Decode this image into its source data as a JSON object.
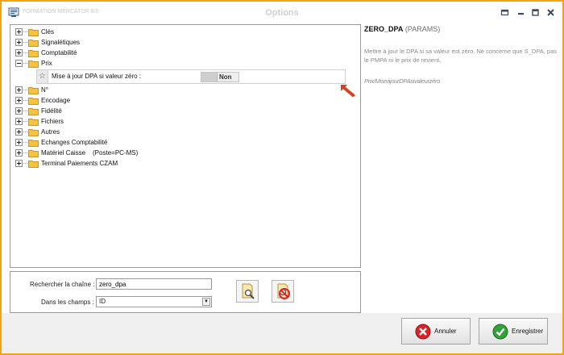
{
  "window": {
    "app_title": "FORMATION MERCATOR 8/0",
    "title": "Options"
  },
  "tree": {
    "items_before": [
      {
        "label": "Clés"
      },
      {
        "label": "Signalétiques"
      },
      {
        "label": "Comptabilité"
      },
      {
        "label": "Prix"
      }
    ],
    "items_after": [
      {
        "label": "N°"
      },
      {
        "label": "Encodage"
      },
      {
        "label": "Fidélité"
      },
      {
        "label": "Fichiers"
      },
      {
        "label": "Autres"
      },
      {
        "label": "Echanges Comptabilité"
      },
      {
        "label": "Matériel Caisse    (Poste=PC-MS)"
      },
      {
        "label": "Terminal Paiements CZAM"
      }
    ],
    "param": {
      "icon": "star-icon",
      "label": "Mise à jour DPA si valeur zéro :",
      "value": "Non"
    }
  },
  "info": {
    "name": "ZERO_DPA",
    "group": "(PARAMS)",
    "description": "Mettre à jour le DPA si sa valeur est zéro. Ne concerne que S_DPA, pas le PMPA ni le prix de revient.",
    "path": "Prix/MiseàjourDPAsivaleurzéro"
  },
  "search": {
    "label": "Rechercher la chaîne :",
    "value": "zero_dpa",
    "fields_label": "Dans les champs :",
    "fields_value": "ID"
  },
  "footer": {
    "cancel_label": "Annuler",
    "save_label": "Enregistrer"
  },
  "colors": {
    "window_border": "#f2a413",
    "arrow": "#d8401f",
    "folder": "#f5c242"
  }
}
